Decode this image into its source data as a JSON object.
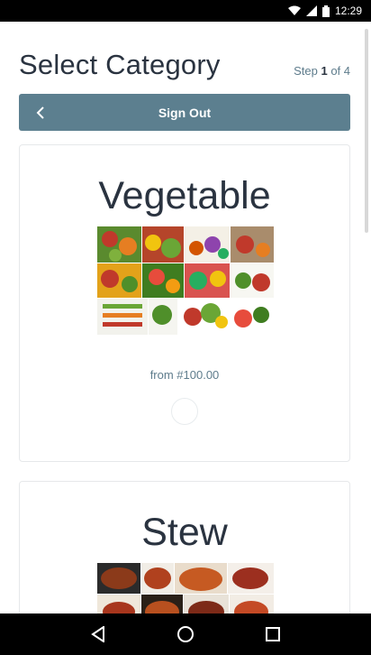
{
  "status_bar": {
    "time": "12:29",
    "icons": [
      "wifi-icon",
      "signal-icon",
      "battery-icon"
    ]
  },
  "header": {
    "title": "Select Category",
    "step_prefix": "Step ",
    "step_current": "1",
    "step_suffix": " of 4"
  },
  "toolbar": {
    "back_icon": "chevron-left-icon",
    "signout_label": "Sign Out"
  },
  "categories": [
    {
      "title": "Vegetable",
      "image": "vegetable-collage-image",
      "price": "from #100.00",
      "selected": false
    },
    {
      "title": "Stew",
      "image": "stew-collage-image"
    }
  ],
  "nav_bar": {
    "icons": [
      "back-triangle-icon",
      "home-circle-icon",
      "recents-square-icon"
    ]
  },
  "colors": {
    "accent": "#5c7f8f",
    "title_text": "#2a3340",
    "muted_text": "#5e7c8c",
    "status_bar_bg": "#000000",
    "nav_bar_bg": "#000000"
  }
}
